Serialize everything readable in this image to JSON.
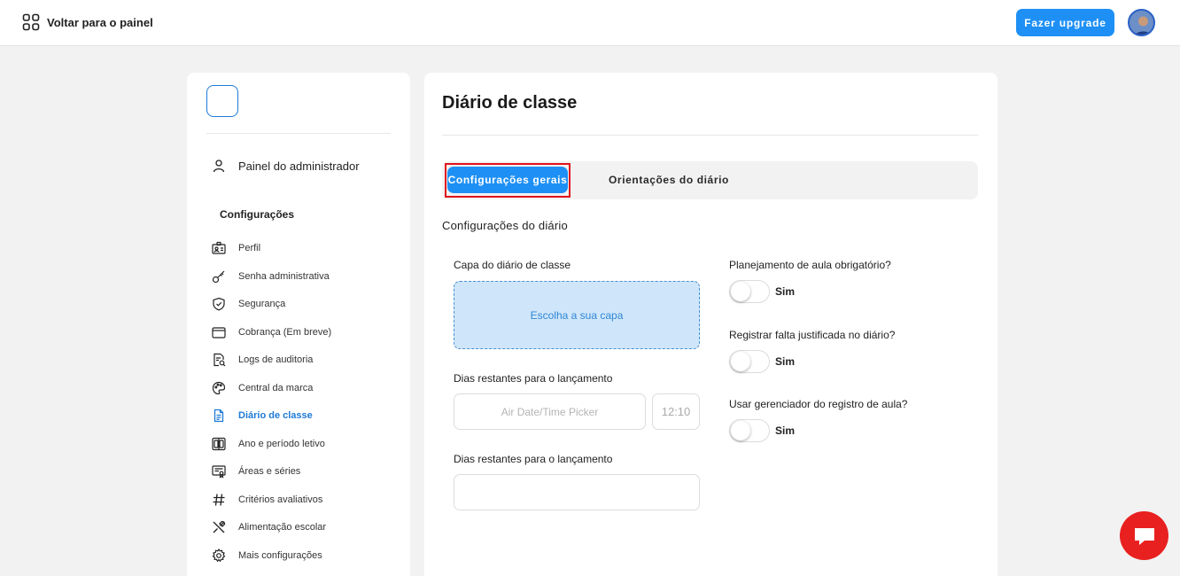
{
  "topbar": {
    "back_label": "Voltar para o painel",
    "upgrade_label": "Fazer upgrade",
    "accent_color": "#1e90f5"
  },
  "sidebar": {
    "admin_label": "Painel do administrador",
    "section_title": "Configurações",
    "items": [
      {
        "label": "Perfil",
        "icon": "id-card-icon",
        "active": false
      },
      {
        "label": "Senha administrativa",
        "icon": "key-icon",
        "active": false
      },
      {
        "label": "Segurança",
        "icon": "shield-icon",
        "active": false
      },
      {
        "label": "Cobrança (Em breve)",
        "icon": "wallet-icon",
        "active": false
      },
      {
        "label": "Logs de auditoria",
        "icon": "audit-log-icon",
        "active": false
      },
      {
        "label": "Central da marca",
        "icon": "palette-icon",
        "active": false
      },
      {
        "label": "Diário de classe",
        "icon": "document-icon",
        "active": true
      },
      {
        "label": "Ano e período letivo",
        "icon": "calendar-grid-icon",
        "active": false
      },
      {
        "label": "Áreas e séries",
        "icon": "certificate-icon",
        "active": false
      },
      {
        "label": "Critérios avaliativos",
        "icon": "hashtag-icon",
        "active": false
      },
      {
        "label": "Alimentação escolar",
        "icon": "utensils-icon",
        "active": false
      },
      {
        "label": "Mais configurações",
        "icon": "gear-icon",
        "active": false
      }
    ]
  },
  "main": {
    "title": "Diário de classe",
    "tabs": [
      {
        "label": "Configurações gerais",
        "active": true
      },
      {
        "label": "Orientações do diário",
        "active": false
      }
    ],
    "section_title": "Configurações do diário",
    "cover": {
      "label": "Capa do diário de classe",
      "placeholder": "Escolha a sua capa"
    },
    "days_field_1": {
      "label": "Dias restantes para o lançamento",
      "date_placeholder": "Air Date/Time Picker",
      "time_placeholder": "12:10"
    },
    "days_field_2": {
      "label": "Dias restantes para o lançamento",
      "value": ""
    },
    "toggles": [
      {
        "label": "Planejamento de aula obrigatório?",
        "state_label": "Sim",
        "checked": false
      },
      {
        "label": "Registrar falta justificada no diário?",
        "state_label": "Sim",
        "checked": false
      },
      {
        "label": "Usar gerenciador do registro de aula?",
        "state_label": "Sim",
        "checked": false
      }
    ]
  },
  "colors": {
    "active_nav": "#1e7ad6",
    "highlight_outline": "#e0141e",
    "chat_button": "#e8201f"
  }
}
